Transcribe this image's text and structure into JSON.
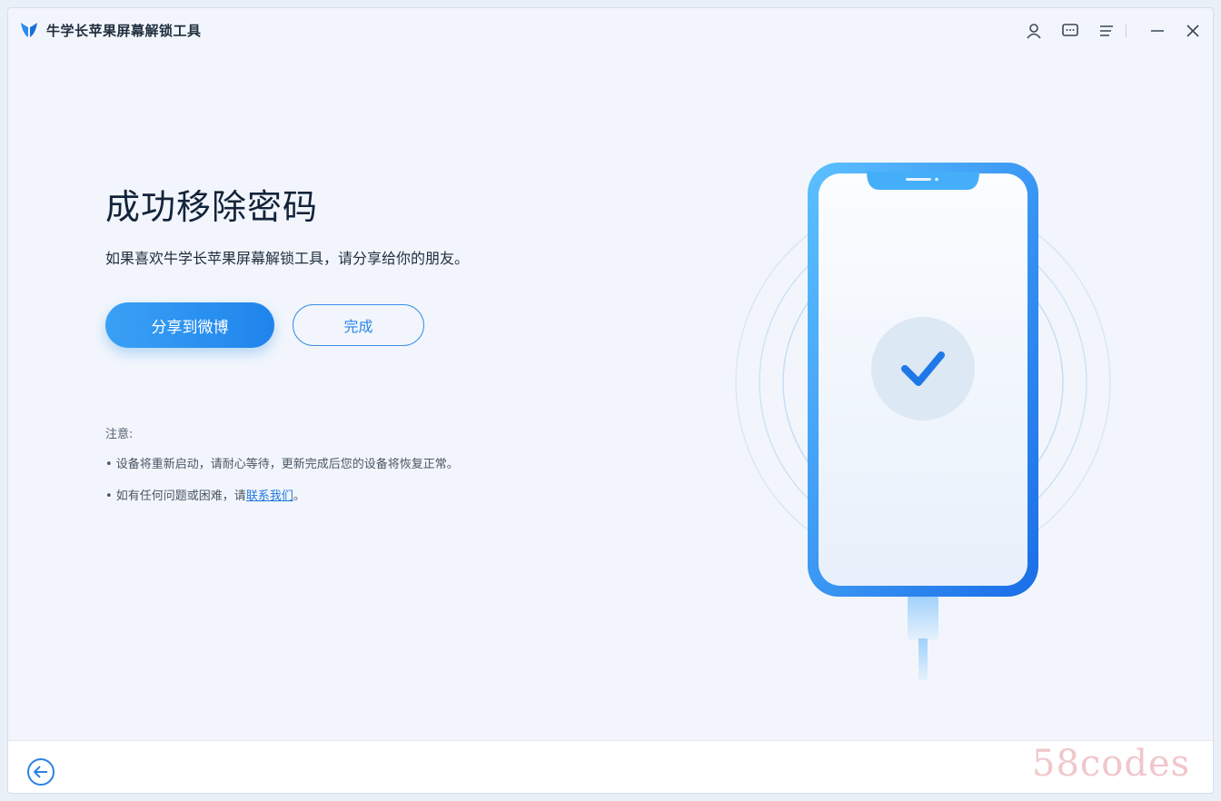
{
  "app": {
    "title": "牛学长苹果屏幕解锁工具"
  },
  "main": {
    "title": "成功移除密码",
    "subtitle": "如果喜欢牛学长苹果屏幕解锁工具，请分享给你的朋友。",
    "share_button": "分享到微博",
    "done_button": "完成"
  },
  "notes": {
    "label": "注意:",
    "item1": "• 设备将重新启动，请耐心等待，更新完成后您的设备将恢复正常。",
    "item2_prefix": "• 如有任何问题或困难，请",
    "item2_link": "联系我们",
    "item2_suffix": "。"
  },
  "watermark": "58codes",
  "colors": {
    "accent": "#1e84ec",
    "title": "#13233a",
    "background": "#f2f6fc"
  },
  "icons": {
    "logo": "app-logo-icon",
    "user": "user-icon",
    "feedback": "message-icon",
    "menu": "menu-icon",
    "minimize": "minimize-icon",
    "close": "close-icon",
    "back": "back-arrow-icon",
    "success": "checkmark-icon"
  }
}
